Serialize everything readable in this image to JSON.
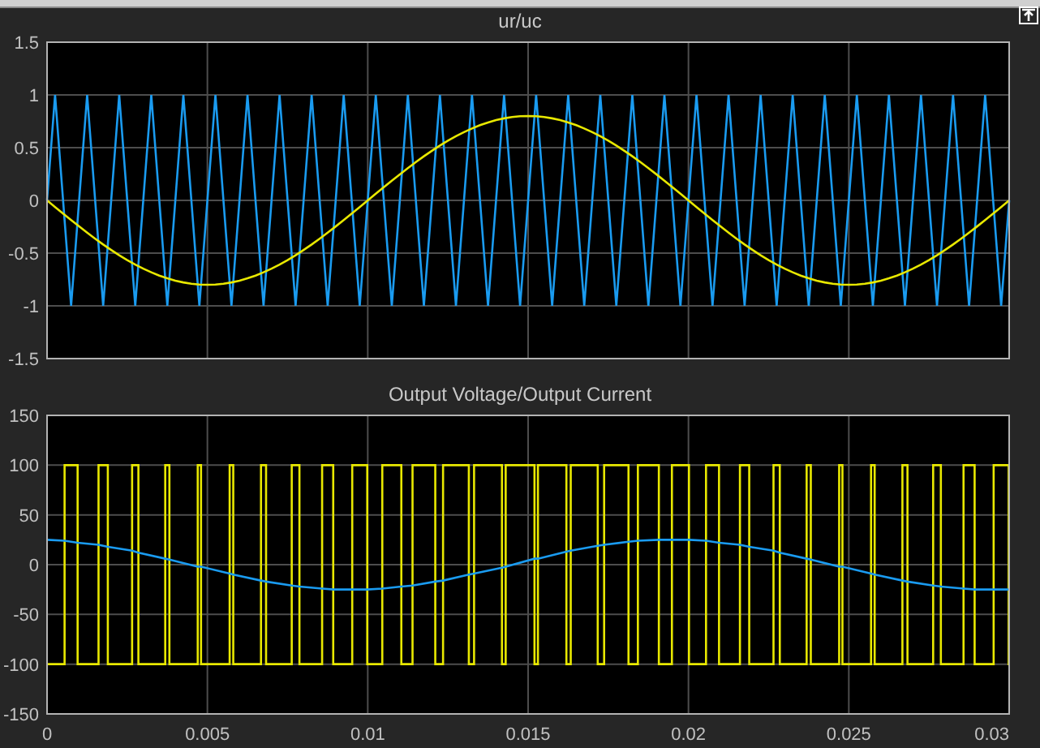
{
  "plots": [
    {
      "chart_data": {
        "type": "line",
        "title": "ur/uc",
        "grid": true,
        "xlim": [
          0,
          0.03
        ],
        "ylim": [
          -1.5,
          1.5
        ],
        "yticks": [
          1.5,
          1,
          0.5,
          0,
          -0.5,
          -1,
          -1.5
        ],
        "x": [
          0,
          0.00025,
          0.0005,
          0.00075,
          0.001,
          0.00125,
          0.0015,
          0.00175,
          0.002,
          0.00225,
          0.0025,
          0.00275,
          0.003,
          0.00325,
          0.0035,
          0.00375,
          0.004,
          0.00425,
          0.0045,
          0.00475,
          0.005,
          0.00525,
          0.0055,
          0.00575,
          0.006,
          0.00625,
          0.0065,
          0.00675,
          0.007,
          0.00725,
          0.0075,
          0.00775,
          0.008,
          0.00825,
          0.0085,
          0.00875,
          0.009,
          0.00925,
          0.0095,
          0.00975,
          0.01,
          0.01025,
          0.0105,
          0.01075,
          0.011,
          0.01125,
          0.0115,
          0.01175,
          0.012,
          0.01225,
          0.0125,
          0.01275,
          0.013,
          0.01325,
          0.0135,
          0.01375,
          0.014,
          0.01425,
          0.0145,
          0.01475,
          0.015,
          0.01525,
          0.0155,
          0.01575,
          0.016,
          0.01625,
          0.0165,
          0.01675,
          0.017,
          0.01725,
          0.0175,
          0.01775,
          0.018,
          0.01825,
          0.0185,
          0.01875,
          0.019,
          0.01925,
          0.0195,
          0.01975,
          0.02,
          0.02025,
          0.0205,
          0.02075,
          0.021,
          0.02125,
          0.0215,
          0.02175,
          0.022,
          0.02225,
          0.0225,
          0.02275,
          0.023,
          0.02325,
          0.0235,
          0.02375,
          0.024,
          0.02425,
          0.0245,
          0.02475,
          0.025,
          0.02525,
          0.0255,
          0.02575,
          0.026,
          0.02625,
          0.0265,
          0.02675,
          0.027,
          0.02725,
          0.0275,
          0.02775,
          0.028,
          0.02825,
          0.0285,
          0.02875,
          0.029,
          0.02925,
          0.0295,
          0.02975,
          0.03
        ],
        "series": [
          {
            "color": "#1a9bf0",
            "values": [
              0,
              1,
              0,
              -1,
              0,
              1,
              0,
              -1,
              0,
              1,
              0,
              -1,
              0,
              1,
              0,
              -1,
              0,
              1,
              0,
              -1,
              0,
              1,
              0,
              -1,
              0,
              1,
              0,
              -1,
              0,
              1,
              0,
              -1,
              0,
              1,
              0,
              -1,
              0,
              1,
              0,
              -1,
              0,
              1,
              0,
              -1,
              0,
              1,
              0,
              -1,
              0,
              1,
              0,
              -1,
              0,
              1,
              0,
              -1,
              0,
              1,
              0,
              -1,
              0,
              1,
              0,
              -1,
              0,
              1,
              0,
              -1,
              0,
              1,
              0,
              -1,
              0,
              1,
              0,
              -1,
              0,
              1,
              0,
              -1,
              0,
              1,
              0,
              -1,
              0,
              1,
              0,
              -1,
              0,
              1,
              0,
              -1,
              0,
              1,
              0,
              -1,
              0,
              1,
              0,
              -1,
              0,
              1,
              0,
              -1,
              0,
              1,
              0,
              -1,
              0,
              1,
              0,
              -1,
              0,
              1,
              0,
              -1,
              0,
              1,
              0,
              -1,
              0
            ]
          },
          {
            "color": "#e8e800",
            "values": [
              0,
              -0.063,
              -0.125,
              -0.187,
              -0.247,
              -0.306,
              -0.363,
              -0.418,
              -0.47,
              -0.52,
              -0.566,
              -0.608,
              -0.647,
              -0.682,
              -0.713,
              -0.739,
              -0.761,
              -0.778,
              -0.79,
              -0.798,
              -0.8,
              -0.798,
              -0.79,
              -0.778,
              -0.761,
              -0.739,
              -0.713,
              -0.682,
              -0.647,
              -0.608,
              -0.566,
              -0.52,
              -0.47,
              -0.418,
              -0.363,
              -0.306,
              -0.247,
              -0.187,
              -0.125,
              -0.063,
              0,
              0.063,
              0.125,
              0.187,
              0.247,
              0.306,
              0.363,
              0.418,
              0.47,
              0.52,
              0.566,
              0.608,
              0.647,
              0.682,
              0.713,
              0.739,
              0.761,
              0.778,
              0.79,
              0.798,
              0.8,
              0.798,
              0.79,
              0.778,
              0.761,
              0.739,
              0.713,
              0.682,
              0.647,
              0.608,
              0.566,
              0.52,
              0.47,
              0.418,
              0.363,
              0.306,
              0.247,
              0.187,
              0.125,
              0.063,
              0,
              -0.063,
              -0.125,
              -0.187,
              -0.247,
              -0.306,
              -0.363,
              -0.418,
              -0.47,
              -0.52,
              -0.566,
              -0.608,
              -0.647,
              -0.682,
              -0.713,
              -0.739,
              -0.761,
              -0.778,
              -0.79,
              -0.798,
              -0.8,
              -0.798,
              -0.79,
              -0.778,
              -0.761,
              -0.739,
              -0.713,
              -0.682,
              -0.647,
              -0.608,
              -0.566,
              -0.52,
              -0.47,
              -0.418,
              -0.363,
              -0.306,
              -0.247,
              -0.187,
              -0.125,
              -0.063,
              0
            ]
          }
        ]
      }
    },
    {
      "chart_data": {
        "type": "line",
        "title": "Output Voltage/Output Current",
        "grid": true,
        "xlim": [
          0,
          0.03
        ],
        "ylim": [
          -150,
          150
        ],
        "xticks": [
          0,
          0.005,
          0.01,
          0.015,
          0.02,
          0.025,
          0.03
        ],
        "yticks": [
          150,
          100,
          50,
          0,
          -50,
          -100,
          -150
        ],
        "x": [
          0,
          0.000547,
          0.000547,
          0.000953,
          0.000953,
          0.001605,
          0.001605,
          0.001895,
          0.001895,
          0.002652,
          0.002652,
          0.002848,
          0.002848,
          0.003685,
          0.003685,
          0.003815,
          0.003815,
          0.004699,
          0.004699,
          0.004801,
          0.004801,
          0.005694,
          0.005694,
          0.005806,
          0.005806,
          0.006671,
          0.006671,
          0.006829,
          0.006829,
          0.00763,
          0.00763,
          0.00787,
          0.00787,
          0.008577,
          0.008577,
          0.008923,
          0.008923,
          0.009516,
          0.009516,
          0.009984,
          0.009984,
          0.010453,
          0.010453,
          0.011047,
          0.011047,
          0.011396,
          0.011396,
          0.012105,
          0.012105,
          0.012348,
          0.012348,
          0.013152,
          0.013152,
          0.013315,
          0.013315,
          0.014185,
          0.014185,
          0.014301,
          0.014301,
          0.015199,
          0.015199,
          0.015306,
          0.015306,
          0.016194,
          0.016194,
          0.016329,
          0.016329,
          0.017171,
          0.017171,
          0.01737,
          0.01737,
          0.01813,
          0.01813,
          0.018423,
          0.018423,
          0.019077,
          0.019077,
          0.019484,
          0.019484,
          0.020016,
          0.020016,
          0.020547,
          0.020547,
          0.020953,
          0.020953,
          0.021605,
          0.021605,
          0.021895,
          0.021895,
          0.022652,
          0.022652,
          0.022848,
          0.022848,
          0.023685,
          0.023685,
          0.023815,
          0.023815,
          0.024699,
          0.024699,
          0.024801,
          0.024801,
          0.025694,
          0.025694,
          0.025806,
          0.025806,
          0.026671,
          0.026671,
          0.026829,
          0.026829,
          0.02763,
          0.02763,
          0.02787,
          0.02787,
          0.028577,
          0.028577,
          0.028923,
          0.028923,
          0.029516,
          0.029516,
          0.029984,
          0.029984,
          0.03
        ],
        "series": [
          {
            "color": "#e8e800",
            "values": [
              -100,
              -100,
              100,
              100,
              -100,
              -100,
              100,
              100,
              -100,
              -100,
              100,
              100,
              -100,
              -100,
              100,
              100,
              -100,
              -100,
              100,
              100,
              -100,
              -100,
              100,
              100,
              -100,
              -100,
              100,
              100,
              -100,
              -100,
              100,
              100,
              -100,
              -100,
              100,
              100,
              -100,
              -100,
              100,
              100,
              -100,
              -100,
              100,
              100,
              -100,
              -100,
              100,
              100,
              -100,
              -100,
              100,
              100,
              -100,
              -100,
              100,
              100,
              -100,
              -100,
              100,
              100,
              -100,
              -100,
              100,
              100,
              -100,
              -100,
              100,
              100,
              -100,
              -100,
              100,
              100,
              -100,
              -100,
              100,
              100,
              -100,
              -100,
              100,
              100,
              -100,
              -100,
              100,
              100,
              -100,
              -100,
              100,
              100,
              -100,
              -100,
              100,
              100,
              -100,
              -100,
              100,
              100,
              -100,
              -100,
              100,
              100,
              -100,
              -100,
              100,
              100,
              -100,
              -100,
              100,
              100,
              -100,
              -100,
              100,
              100,
              -100,
              -100,
              100,
              100,
              -100,
              -100,
              100,
              100,
              -100,
              -100
            ]
          },
          {
            "color": "#1a9bf0",
            "values": [
              25,
              24,
              24,
              22,
              22,
              20,
              20,
              18,
              18,
              14,
              14,
              12,
              12,
              6,
              6,
              5,
              5,
              -2,
              -2,
              -2,
              -2,
              -9,
              -9,
              -10,
              -10,
              -16,
              -16,
              -17,
              -17,
              -21,
              -21,
              -22,
              -22,
              -24,
              -24,
              -25,
              -25,
              -25,
              -25,
              -25,
              -25,
              -24,
              -24,
              -22,
              -22,
              -21,
              -21,
              -17,
              -17,
              -16,
              -16,
              -10,
              -10,
              -9,
              -9,
              -3,
              -3,
              -2,
              -2,
              6,
              6,
              6,
              6,
              13,
              13,
              14,
              14,
              19,
              19,
              20,
              20,
              23,
              23,
              24,
              24,
              25,
              25,
              25,
              25,
              25,
              25,
              24,
              24,
              22,
              22,
              20,
              20,
              18,
              18,
              14,
              14,
              12,
              12,
              6,
              6,
              5,
              5,
              -2,
              -2,
              -2,
              -2,
              -9,
              -9,
              -10,
              -10,
              -16,
              -16,
              -17,
              -17,
              -21,
              -21,
              -22,
              -22,
              -24,
              -24,
              -25,
              -25,
              -25,
              -25,
              -25,
              -25,
              -25
            ]
          }
        ]
      }
    }
  ]
}
